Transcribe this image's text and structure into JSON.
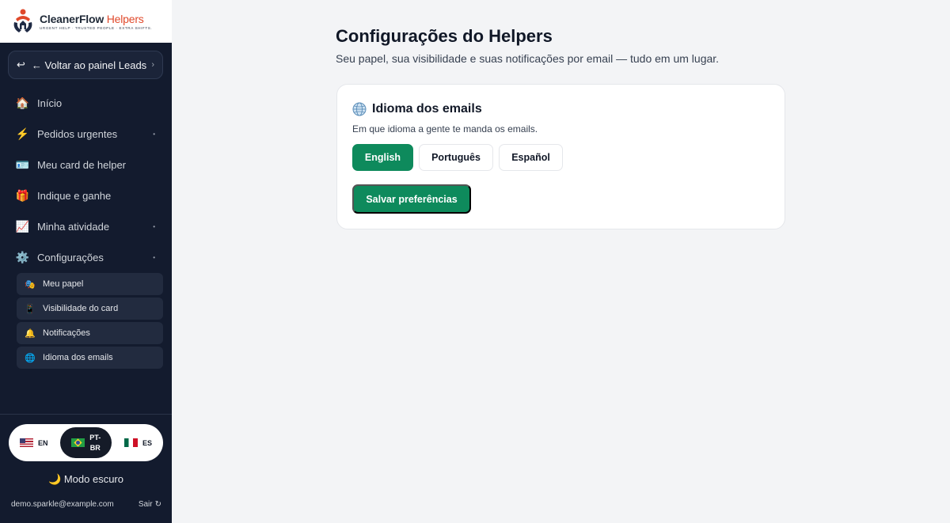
{
  "brand": {
    "name": "CleanerFlow",
    "name_accent": "Helpers",
    "tagline": "URGENT HELP · TRUSTED PEOPLE · EXTRA SHIFTS."
  },
  "sidebar": {
    "back_label": "← Voltar ao painel Leads",
    "back_icon": "↩",
    "items": [
      {
        "label": "Início",
        "icon": "🏠"
      },
      {
        "label": "Pedidos urgentes",
        "icon": "⚡"
      },
      {
        "label": "Meu card de helper",
        "icon": "🪪"
      },
      {
        "label": "Indique e ganhe",
        "icon": "🎁"
      },
      {
        "label": "Minha atividade",
        "icon": "📈"
      },
      {
        "label": "Configurações",
        "icon": "⚙️"
      }
    ],
    "sub_items": [
      {
        "label": "Meu papel",
        "icon": "🎭"
      },
      {
        "label": "Visibilidade do card",
        "icon": "📱"
      },
      {
        "label": "Notificações",
        "icon": "🔔"
      },
      {
        "label": "Idioma dos emails",
        "icon": "🌐"
      }
    ],
    "language_switch": {
      "options": [
        {
          "code": "EN"
        },
        {
          "code_line1": "PT-",
          "code_line2": "BR"
        },
        {
          "code": "ES"
        }
      ],
      "active": "PT-BR"
    },
    "dark_mode_label": "Modo escuro",
    "dark_mode_icon": "🌙",
    "user_email": "demo.sparkle@example.com",
    "logout_label": "Sair",
    "logout_icon": "↻"
  },
  "main": {
    "title": "Configurações do Helpers",
    "subtitle": "Seu papel, sua visibilidade e suas notificações por email — tudo em um lugar.",
    "card": {
      "title": "Idioma dos emails",
      "description": "Em que idioma a gente te manda os emails.",
      "options": [
        "English",
        "Português",
        "Español"
      ],
      "selected": "English",
      "save_label": "Salvar preferências"
    }
  },
  "colors": {
    "sidebar_bg": "#131b2e",
    "accent_green": "#0e8a5c",
    "brand_red": "#e0492b"
  }
}
